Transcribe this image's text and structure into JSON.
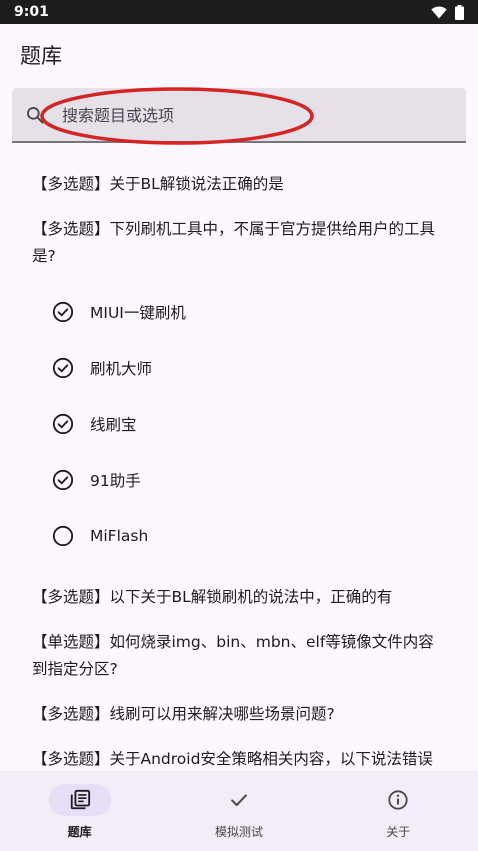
{
  "status_bar": {
    "time": "9:01"
  },
  "app_bar": {
    "title": "题库"
  },
  "search": {
    "placeholder": "搜索题目或选项"
  },
  "questions": [
    {
      "text": "【多选题】关于BL解锁说法正确的是"
    },
    {
      "text": "【多选题】下列刷机工具中，不属于官方提供给用户的工具是?",
      "options": [
        {
          "label": "MIUI一键刷机",
          "checked": true
        },
        {
          "label": "刷机大师",
          "checked": true
        },
        {
          "label": "线刷宝",
          "checked": true
        },
        {
          "label": "91助手",
          "checked": true
        },
        {
          "label": "MiFlash",
          "checked": false
        }
      ]
    },
    {
      "text": "【多选题】以下关于BL解锁刷机的说法中，正确的有"
    },
    {
      "text": "【单选题】如何烧录img、bin、mbn、elf等镜像文件内容到指定分区?"
    },
    {
      "text": "【多选题】线刷可以用来解决哪些场景问题?"
    },
    {
      "text": "【多选题】关于Android安全策略相关内容，以下说法错误"
    }
  ],
  "bottom_nav": [
    {
      "label": "题库",
      "icon": "library-icon",
      "active": true
    },
    {
      "label": "模拟测试",
      "icon": "check-icon",
      "active": false
    },
    {
      "label": "关于",
      "icon": "info-icon",
      "active": false
    }
  ],
  "colors": {
    "background": "#fdf7ff",
    "search_field": "#e6e0e9",
    "nav_active": "#e8def8",
    "annotation": "#d42424"
  }
}
